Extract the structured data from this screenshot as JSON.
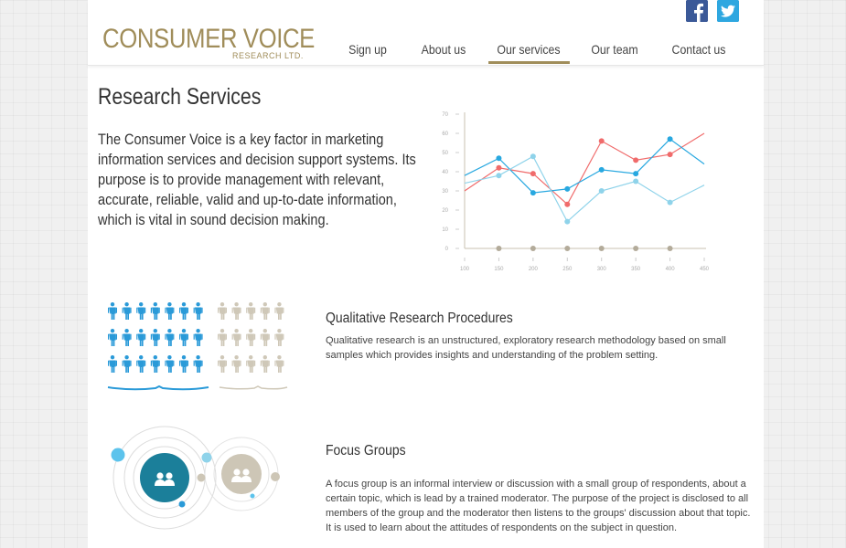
{
  "brand": {
    "name": "CONSUMER VOICE",
    "tagline": "RESEARCH LTD.",
    "color": "#a08d5a"
  },
  "social": [
    {
      "name": "facebook",
      "icon": "facebook-icon",
      "color": "#3b5998"
    },
    {
      "name": "twitter",
      "icon": "twitter-icon",
      "color": "#2ea7e0"
    }
  ],
  "nav": {
    "items": [
      {
        "label": "Sign up"
      },
      {
        "label": "About us"
      },
      {
        "label": "Our services",
        "active": true
      },
      {
        "label": "Our team"
      },
      {
        "label": "Contact us"
      }
    ]
  },
  "main": {
    "title": "Research Services",
    "intro": "The Consumer Voice is a key factor in marketing information services and decision support systems. Its purpose is to provide management with relevant, accurate, reliable, valid and up-to-date information, which is vital in sound decision making."
  },
  "chart_data": {
    "type": "line",
    "x_ticks": [
      100,
      150,
      200,
      250,
      300,
      350,
      400,
      450
    ],
    "y_ticks": [
      0,
      10,
      20,
      30,
      40,
      50,
      60,
      70
    ],
    "xlim": [
      100,
      450
    ],
    "ylim": [
      0,
      70
    ],
    "grid": false,
    "series": [
      {
        "color": "#f06b6b",
        "x": [
          100,
          150,
          200,
          250,
          300,
          350,
          400,
          450
        ],
        "values": [
          30,
          42,
          39,
          23,
          56,
          46,
          49,
          60
        ]
      },
      {
        "color": "#28a8e0",
        "x": [
          100,
          150,
          200,
          250,
          300,
          350,
          400,
          450
        ],
        "values": [
          38,
          47,
          29,
          31,
          41,
          39,
          57,
          44
        ]
      },
      {
        "color": "#8fd3ea",
        "x": [
          100,
          150,
          200,
          250,
          300,
          350,
          400,
          450
        ],
        "values": [
          34,
          38,
          48,
          14,
          30,
          35,
          24,
          33
        ]
      },
      {
        "color": "#b3ab9a",
        "x": [
          150,
          200,
          250,
          300,
          350,
          400
        ],
        "values": [
          0,
          0,
          0,
          0,
          0,
          0
        ]
      }
    ]
  },
  "sections": [
    {
      "title": "Qualitative Research Procedures",
      "text": "Qualitative research is an unstructured, exploratory research methodology based on small samples which provides insights and understanding of the problem setting.",
      "illustration": {
        "blue_people": 21,
        "beige_people": 15,
        "blue": "#2a9ad8",
        "beige": "#cfc8b8"
      }
    },
    {
      "title": "Focus Groups",
      "text": "A focus group is an informal interview or discussion with a small group of respondents, about a certain topic, which is lead by a trained moderator. The purpose of the project is disclosed to all members of the group and the moderator then listens to the groups' discussion about that topic. It is used to learn about the attitudes of respondents on the subject in question.",
      "illustration": {
        "main_color": "#1b7f9a",
        "second_color": "#cdc6b6",
        "accent": "#5cc3ec"
      }
    }
  ]
}
